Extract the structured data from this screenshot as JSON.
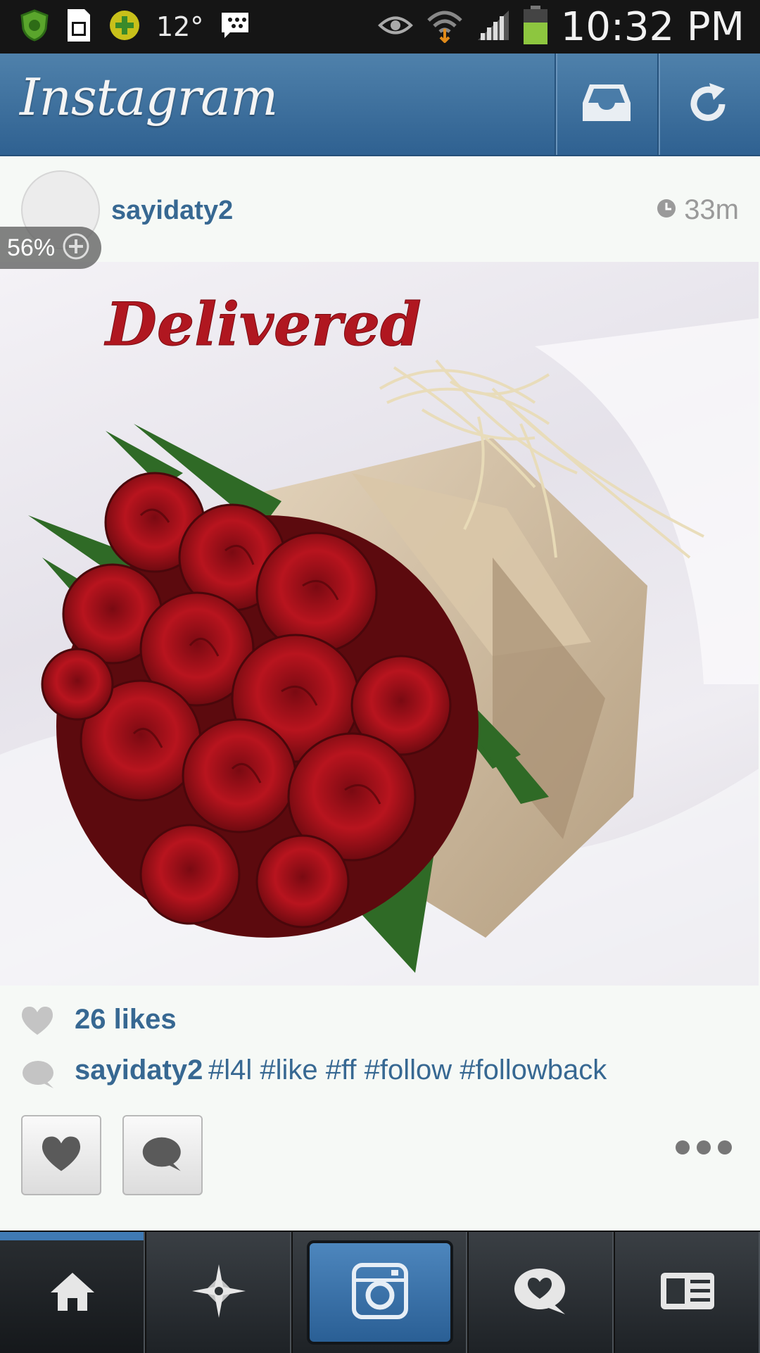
{
  "status_bar": {
    "temperature": "12°",
    "time": "10:32 PM",
    "battery_color": "#8dc63f"
  },
  "header": {
    "title": "Instagram",
    "inbox_icon": "inbox-icon",
    "refresh_icon": "refresh-icon"
  },
  "post": {
    "username": "sayidaty2",
    "time_ago": "33m",
    "zoom_level": "56%",
    "photo_text": "Delivered",
    "likes": "26 likes",
    "caption_user": "sayidaty2",
    "caption_tags": "#l4l #like #ff #follow #followback"
  },
  "actions": {
    "like_icon": "heart-icon",
    "comment_icon": "comment-icon",
    "more_icon": "more-icon"
  },
  "bottom_nav": {
    "items": [
      "home-icon",
      "explore-icon",
      "camera-icon",
      "news-icon",
      "profile-icon"
    ],
    "active_index": 0,
    "accent": "#3f7ab4"
  }
}
